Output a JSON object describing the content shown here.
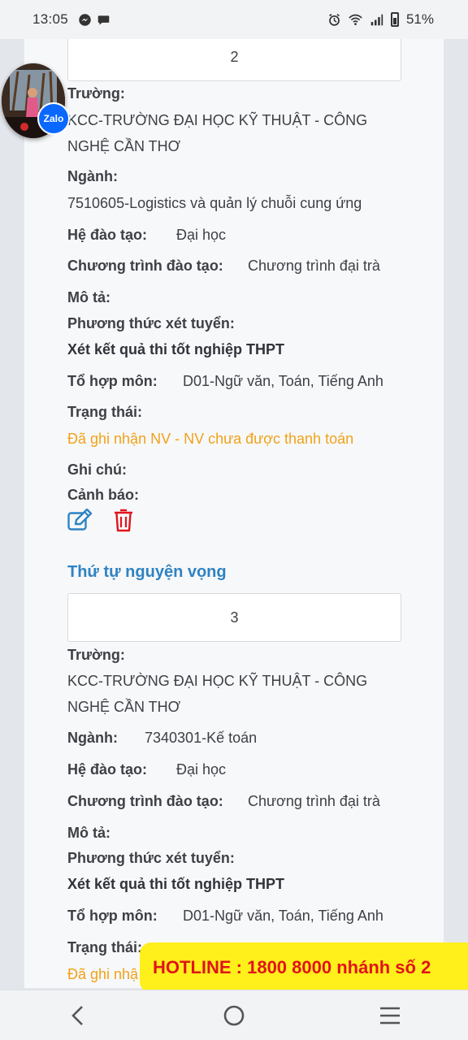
{
  "status_bar": {
    "time": "13:05",
    "battery": "51%",
    "icons": [
      "messenger-icon",
      "chat-icon",
      "alarm-icon",
      "wifi-icon",
      "signal-icon",
      "battery-icon"
    ]
  },
  "wish_top": {
    "order_value": "2",
    "school_label": "Trường:",
    "school_value": "KCC-TRƯỜNG ĐẠI HỌC KỸ THUẬT - CÔNG NGHỆ CẦN THƠ",
    "major_label": "Ngành:",
    "major_value": "7510605-Logistics và quản lý chuỗi cung ứng",
    "system_label": "Hệ đào tạo:",
    "system_value": "Đại học",
    "program_label": "Chương trình đào tạo:",
    "program_value": "Chương trình đại trà",
    "desc_label": "Mô tả:",
    "method_label": "Phương thức xét tuyển:",
    "method_value": "Xét kết quả thi tốt nghiệp THPT",
    "combo_label": "Tổ hợp môn:",
    "combo_value": "D01-Ngữ văn, Toán, Tiếng Anh",
    "status_label": "Trạng thái:",
    "status_value": "Đã ghi nhận NV - NV chưa được thanh toán",
    "note_label": "Ghi chú:",
    "alert_label": "Cảnh báo:"
  },
  "wish_bottom": {
    "section_title": "Thứ tự nguyện vọng",
    "order_value": "3",
    "school_label": "Trường:",
    "school_value": "KCC-TRƯỜNG ĐẠI HỌC KỸ THUẬT - CÔNG NGHỆ CẦN THƠ",
    "major_label": "Ngành:",
    "major_value": "7340301-Kế toán",
    "system_label": "Hệ đào tạo:",
    "system_value": "Đại học",
    "program_label": "Chương trình đào tạo:",
    "program_value": "Chương trình đại trà",
    "desc_label": "Mô tả:",
    "method_label": "Phương thức xét tuyển:",
    "method_value": "Xét kết quả thi tốt nghiệp THPT",
    "combo_label": "Tổ hợp môn:",
    "combo_value": "D01-Ngữ văn, Toán, Tiếng Anh",
    "status_label": "Trạng thái:",
    "status_value_partial": "Đã ghi nhậ"
  },
  "zalo": {
    "badge_text": "Zalo"
  },
  "hotline": {
    "text": "HOTLINE : 1800 8000 nhánh số 2"
  },
  "colors": {
    "accent": "#2f83c2",
    "warning": "#f0a21a",
    "delete": "#e0141a",
    "hotline_bg": "#ffef1a"
  }
}
